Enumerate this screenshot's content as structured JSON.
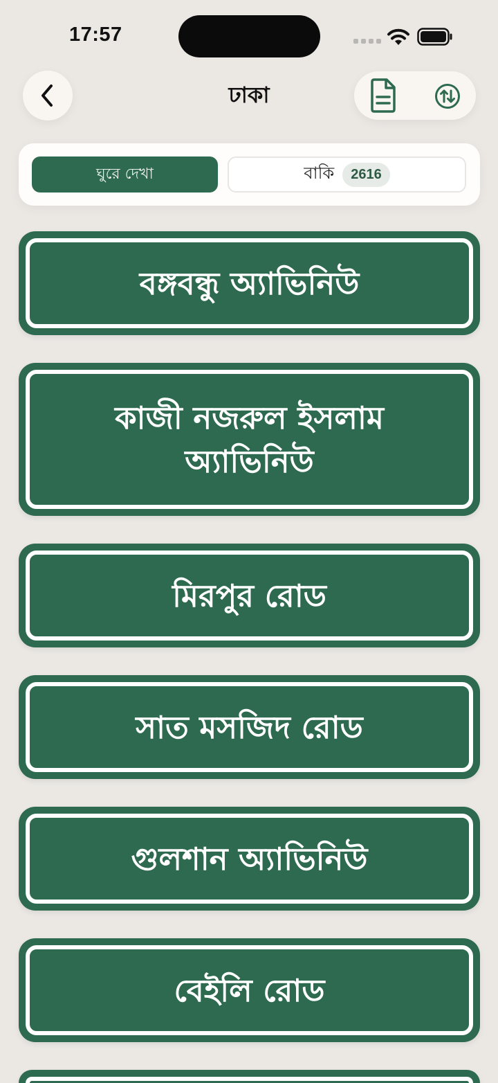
{
  "status_bar": {
    "time": "17:57"
  },
  "header": {
    "title": "ঢাকা",
    "icons": {
      "back": "chevron-left-icon",
      "document": "document-icon",
      "sort": "sort-arrows-icon"
    }
  },
  "tabs": {
    "explore_label": "ঘুরে দেখা",
    "remaining_label": "বাকি",
    "remaining_count": "2616"
  },
  "places": [
    {
      "name": "বঙ্গবন্ধু অ্যাভিনিউ"
    },
    {
      "name": "কাজী নজরুল ইসলাম অ্যাভিনিউ"
    },
    {
      "name": "মিরপুর রোড"
    },
    {
      "name": "সাত মসজিদ রোড"
    },
    {
      "name": "গুলশান অ্যাভিনিউ"
    },
    {
      "name": "বেইলি রোড"
    },
    {
      "name": ""
    }
  ],
  "colors": {
    "background": "#ebe8e4",
    "card_green": "#2e6a50",
    "surface": "#f9f6f2"
  }
}
